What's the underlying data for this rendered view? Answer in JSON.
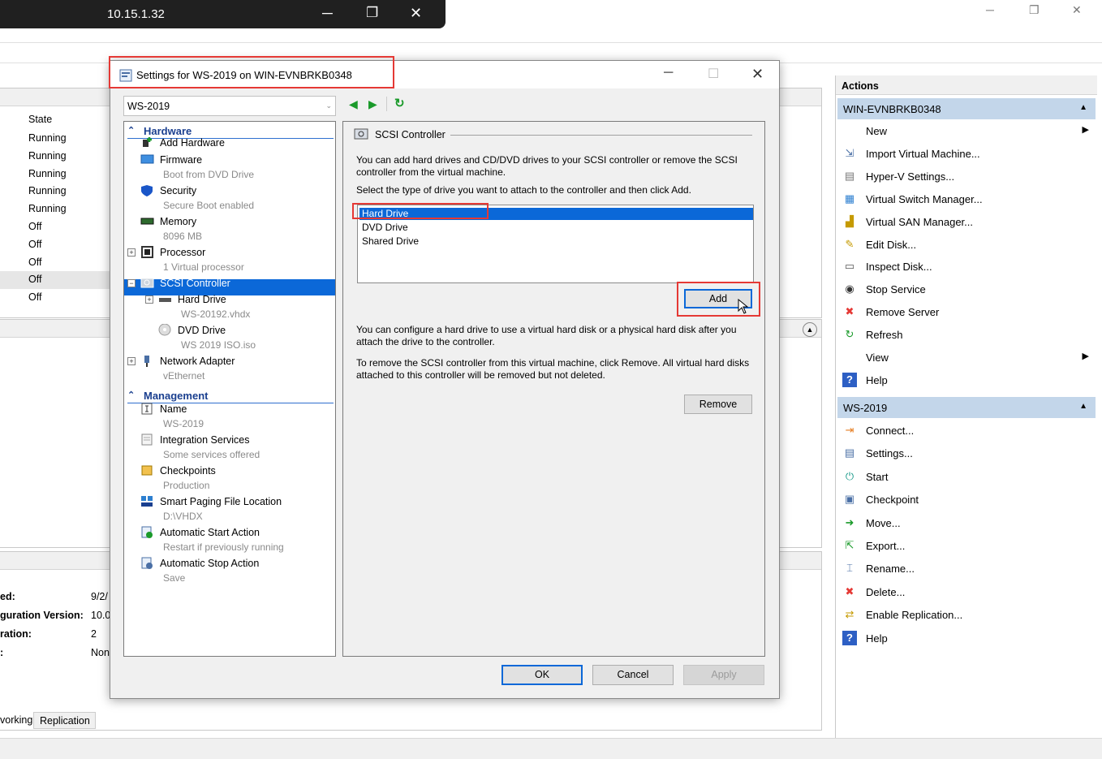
{
  "remote_bar": {
    "ip": "10.15.1.32",
    "min": "─",
    "restore": "❐",
    "close": "✕"
  },
  "main_window": {
    "min": "─",
    "restore": "❐",
    "close": "✕"
  },
  "vm_list": {
    "state_header": "State",
    "states": [
      "Running",
      "Running",
      "Running",
      "Running",
      "Running",
      "Off",
      "Off",
      "Off",
      "Off",
      "Off"
    ]
  },
  "details": {
    "rows": [
      {
        "label": "ed:",
        "value": "9/2/"
      },
      {
        "label": "guration Version:",
        "value": "10.0"
      },
      {
        "label": "ration:",
        "value": "2"
      },
      {
        "label": ":",
        "value": "Non"
      }
    ],
    "tabs": [
      "vorking",
      "Replication"
    ]
  },
  "dialog": {
    "title": "Settings for WS-2019 on WIN-EVNBRKB0348",
    "vm_select": "WS-2019",
    "hardware_label": "Hardware",
    "management_label": "Management",
    "hardware_items": [
      {
        "label": "Add Hardware",
        "sub": ""
      },
      {
        "label": "Firmware",
        "sub": "Boot from DVD Drive"
      },
      {
        "label": "Security",
        "sub": "Secure Boot enabled"
      },
      {
        "label": "Memory",
        "sub": "8096 MB"
      },
      {
        "label": "Processor",
        "sub": "1 Virtual processor"
      },
      {
        "label": "SCSI Controller",
        "sub": ""
      },
      {
        "label": "Hard Drive",
        "sub": "WS-20192.vhdx"
      },
      {
        "label": "DVD Drive",
        "sub": "WS 2019 ISO.iso"
      },
      {
        "label": "Network Adapter",
        "sub": "vEthernet"
      }
    ],
    "management_items": [
      {
        "label": "Name",
        "sub": "WS-2019"
      },
      {
        "label": "Integration Services",
        "sub": "Some services offered"
      },
      {
        "label": "Checkpoints",
        "sub": "Production"
      },
      {
        "label": "Smart Paging File Location",
        "sub": "D:\\VHDX"
      },
      {
        "label": "Automatic Start Action",
        "sub": "Restart if previously running"
      },
      {
        "label": "Automatic Stop Action",
        "sub": "Save"
      }
    ],
    "pane": {
      "group_title": "SCSI Controller",
      "intro": "You can add hard drives and CD/DVD drives to your SCSI controller or remove the SCSI controller from the virtual machine.",
      "select_prompt": "Select the type of drive you want to attach to the controller and then click Add.",
      "drive_types": [
        "Hard Drive",
        "DVD Drive",
        "Shared Drive"
      ],
      "add_label": "Add",
      "configure_text": "You can configure a hard drive to use a virtual hard disk or a physical hard disk after you attach the drive to the controller.",
      "remove_text": "To remove the SCSI controller from this virtual machine, click Remove. All virtual hard disks attached to this controller will be removed but not deleted.",
      "remove_label": "Remove"
    },
    "ok_label": "OK",
    "cancel_label": "Cancel",
    "apply_label": "Apply"
  },
  "actions": {
    "header": "Actions",
    "server_group": "WIN-EVNBRKB0348",
    "server_items": [
      "New",
      "Import Virtual Machine...",
      "Hyper-V Settings...",
      "Virtual Switch Manager...",
      "Virtual SAN Manager...",
      "Edit Disk...",
      "Inspect Disk...",
      "Stop Service",
      "Remove Server",
      "Refresh",
      "View",
      "Help"
    ],
    "vm_group": "WS-2019",
    "vm_items": [
      "Connect...",
      "Settings...",
      "Start",
      "Checkpoint",
      "Move...",
      "Export...",
      "Rename...",
      "Delete...",
      "Enable Replication...",
      "Help"
    ]
  },
  "colors": {
    "accent": "#0b68d8",
    "highlight_box": "#e53935",
    "group_header": "#c3d6ea"
  }
}
